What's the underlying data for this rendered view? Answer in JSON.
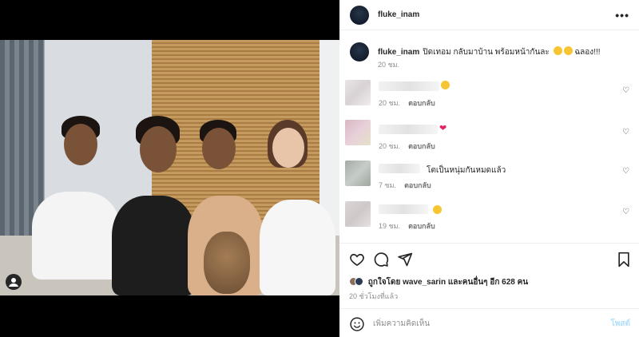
{
  "post": {
    "author": "fluke_inam",
    "caption": "ปิดเทอม กลับมาบ้าน พร้อมหน้ากันละ",
    "caption_tail": "ฉลอง!!!",
    "caption_time": "20 ชม."
  },
  "comments": [
    {
      "text": "",
      "time": "20 ชม.",
      "reply": "ตอบกลับ",
      "emoji": "star-struck-emoji"
    },
    {
      "text": "",
      "time": "20 ชม.",
      "reply": "ตอบกลับ",
      "emoji": "red-heart-emoji"
    },
    {
      "text": "โตเป็นหนุ่มกันหมดแล้ว",
      "time": "7 ชม.",
      "reply": "ตอบกลับ"
    },
    {
      "text": "",
      "time": "19 ชม.",
      "reply": "ตอบกลับ",
      "emoji": "star-struck-emoji"
    }
  ],
  "likes": {
    "prefix": "ถูกใจโดย",
    "user": "wave_sarin",
    "suffix": "และคนอื่นๆ อีก 628 คน"
  },
  "post_time": "20 ชั่วโมงที่แล้ว",
  "comment_box": {
    "placeholder": "เพิ่มความคิดเห็น",
    "post_label": "โพสต์"
  },
  "icons": [
    "more-icon",
    "heart-icon",
    "comment-icon",
    "share-icon",
    "bookmark-icon",
    "emoji-icon",
    "user-tag-icon"
  ],
  "colors": {
    "link_blue_disabled": "#b2dffc",
    "heart_red": "#e0245e",
    "muted": "#8e8e8e"
  }
}
